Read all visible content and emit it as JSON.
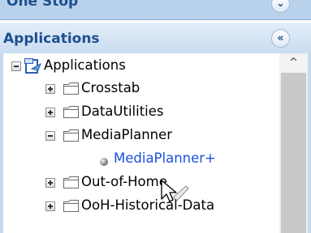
{
  "top_panel": {
    "title": "One Stop",
    "button_icon": "chevron-down-icon"
  },
  "applications_panel": {
    "title": "Applications",
    "button_icon": "double-chevron-up-icon",
    "tree": {
      "root": {
        "label": "Applications",
        "expanded": true,
        "icon": "application-icon"
      },
      "items": [
        {
          "label": "Crosstab",
          "expanded": false,
          "icon": "folder-icon"
        },
        {
          "label": "DataUtilities",
          "expanded": false,
          "icon": "folder-icon"
        },
        {
          "label": "MediaPlanner",
          "expanded": true,
          "icon": "folder-icon",
          "children": [
            {
              "label": "MediaPlanner+",
              "icon": "bullet-icon"
            }
          ]
        },
        {
          "label": "Out-of-Home",
          "expanded": false,
          "icon": "folder-icon"
        },
        {
          "label": "OoH-Historical-Data",
          "expanded": false,
          "icon": "folder-icon"
        }
      ]
    },
    "scrollbar": {
      "up_arrow": "^"
    }
  },
  "colors": {
    "panel_title": "#1d4f8d",
    "link": "#1a4fe0",
    "panel_bg": "#c6d9ef"
  }
}
